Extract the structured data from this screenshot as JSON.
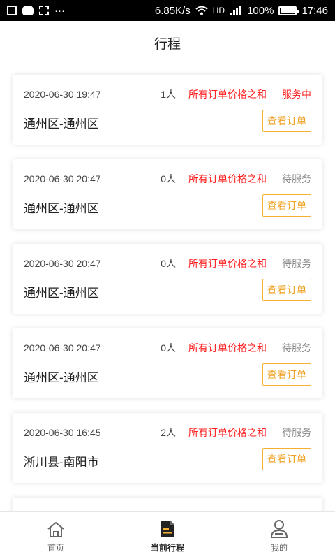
{
  "status_bar": {
    "speed": "6.85K/s",
    "network": "HD",
    "battery": "100%",
    "time": "17:46",
    "battery_level": 1.0
  },
  "header": {
    "title": "行程"
  },
  "trips": [
    {
      "date": "2020-06-30 19:47",
      "count": "1人",
      "price": "所有订单价格之和",
      "status": "服务中",
      "status_type": "active",
      "route": "通州区-通州区",
      "button": "查看订单"
    },
    {
      "date": "2020-06-30 20:47",
      "count": "0人",
      "price": "所有订单价格之和",
      "status": "待服务",
      "status_type": "pending",
      "route": "通州区-通州区",
      "button": "查看订单"
    },
    {
      "date": "2020-06-30 20:47",
      "count": "0人",
      "price": "所有订单价格之和",
      "status": "待服务",
      "status_type": "pending",
      "route": "通州区-通州区",
      "button": "查看订单"
    },
    {
      "date": "2020-06-30 20:47",
      "count": "0人",
      "price": "所有订单价格之和",
      "status": "待服务",
      "status_type": "pending",
      "route": "通州区-通州区",
      "button": "查看订单"
    },
    {
      "date": "2020-06-30 16:45",
      "count": "2人",
      "price": "所有订单价格之和",
      "status": "待服务",
      "status_type": "pending",
      "route": "淅川县-南阳市",
      "button": "查看订单"
    }
  ],
  "tabbar": {
    "items": [
      {
        "label": "首页",
        "icon": "home-icon",
        "active": false
      },
      {
        "label": "当前行程",
        "icon": "document-icon",
        "active": true
      },
      {
        "label": "我的",
        "icon": "user-icon",
        "active": false
      }
    ]
  },
  "colors": {
    "accent": "#f5b031",
    "price_red": "#ff1f1f",
    "pending_gray": "#888888"
  }
}
